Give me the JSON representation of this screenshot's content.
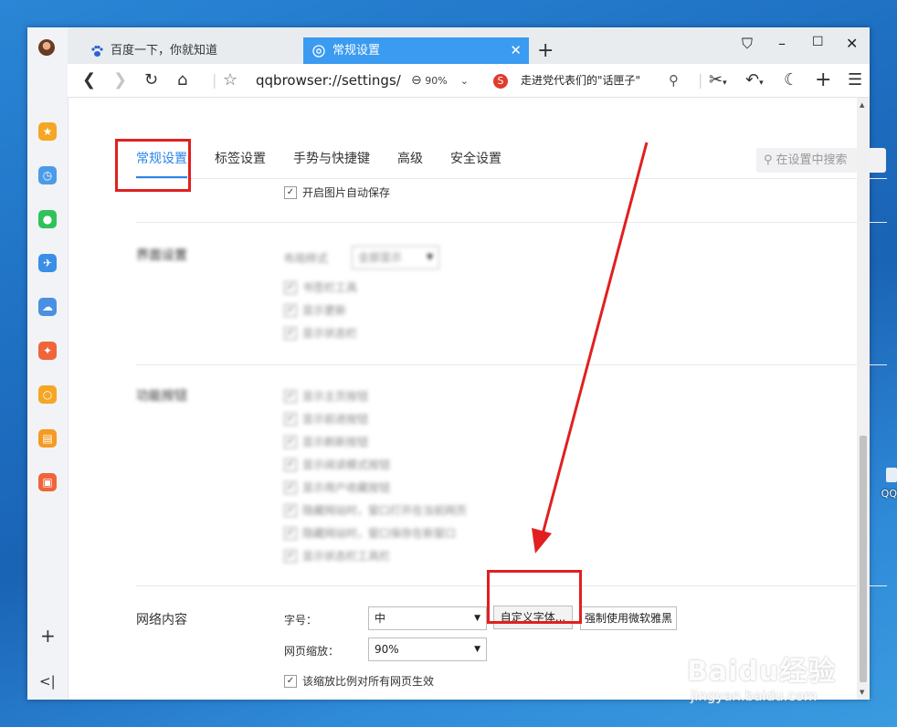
{
  "browser": {
    "tabs": [
      {
        "label": "百度一下，你就知道",
        "icon": "paw-icon"
      },
      {
        "label": "常规设置",
        "icon": "settings-icon"
      }
    ],
    "new_tab": "+",
    "window_controls": {
      "skin": "⛉",
      "minimize": "–",
      "maximize": "☐",
      "close": "✕"
    }
  },
  "toolbar": {
    "url": "qqbrowser://settings/",
    "zoom": "90%",
    "news_logo": "S",
    "news": "走进党代表们的\"话匣子\""
  },
  "sidebar": {
    "items": [
      {
        "icon": "star-icon",
        "color": "#f5a623"
      },
      {
        "icon": "clock-icon",
        "color": "#4a9be8"
      },
      {
        "icon": "wechat-icon",
        "color": "#2fc25b"
      },
      {
        "icon": "plane-icon",
        "color": "#3a8ee6"
      },
      {
        "icon": "cloud-icon",
        "color": "#4a90e2"
      },
      {
        "icon": "pdf-icon",
        "color": "#f0643c"
      },
      {
        "icon": "search-app-icon",
        "color": "#f5a623"
      },
      {
        "icon": "book-icon",
        "color": "#f59a23"
      },
      {
        "icon": "photo-icon",
        "color": "#f0643c"
      }
    ],
    "add": "+",
    "collapse": "<|"
  },
  "settings_nav": [
    "常规设置",
    "标签设置",
    "手势与快捷键",
    "高级",
    "安全设置"
  ],
  "search": {
    "placeholder": "在设置中搜索"
  },
  "image_autosave": {
    "label": "开启图片自动保存",
    "checked": true
  },
  "blurred_section_1": {
    "title": "界面设置",
    "select_label": "布局样式",
    "select_value": "全部显示",
    "options": [
      "书签栏工具",
      "显示更新",
      "显示状态栏"
    ]
  },
  "blurred_section_2": {
    "title": "功能按钮",
    "options": [
      "显示主页按钮",
      "显示前进按钮",
      "显示刷新按钮",
      "显示阅读模式按钮",
      "显示用户收藏按钮",
      "隐藏网站时，窗口打开在当前网页",
      "隐藏网站时，窗口保存在新窗口",
      "显示状态栏工具栏"
    ]
  },
  "web_content": {
    "title": "网络内容",
    "font_size_label": "字号：",
    "font_size_value": "中",
    "custom_font_button": "自定义字体...",
    "force_yahei_button": "强制使用微软雅黑",
    "zoom_label": "网页缩放：",
    "zoom_value": "90%",
    "zoom_all_label": "该缩放比例对所有网页生效",
    "zoom_all_checked": true
  },
  "watermark": {
    "brand": "Baidu经验",
    "url": "jingyan.baidu.com"
  },
  "desktop": {
    "icon_label": "QQ"
  }
}
